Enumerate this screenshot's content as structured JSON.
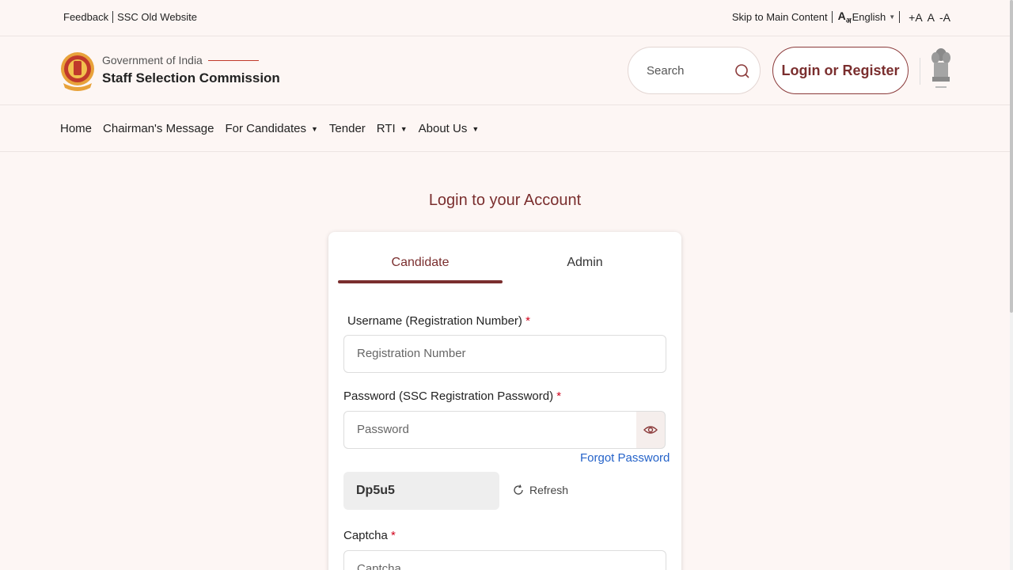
{
  "topbar": {
    "feedback": "Feedback",
    "old_website": "SSC Old Website",
    "skip": "Skip to Main Content",
    "lang_icon": "A",
    "lang_icon_sub": "अ",
    "language": "English",
    "font_increase": "+A",
    "font_normal": "A",
    "font_decrease": "-A"
  },
  "header": {
    "gov": "Government of India",
    "org": "Staff Selection Commission",
    "search_placeholder": "Search",
    "login_register": "Login or Register"
  },
  "nav": {
    "items": [
      {
        "label": "Home",
        "dropdown": false
      },
      {
        "label": "Chairman's Message",
        "dropdown": false
      },
      {
        "label": "For Candidates",
        "dropdown": true
      },
      {
        "label": "Tender",
        "dropdown": false
      },
      {
        "label": "RTI",
        "dropdown": true
      },
      {
        "label": "About Us",
        "dropdown": true
      }
    ]
  },
  "login": {
    "title": "Login to your Account",
    "tabs": [
      "Candidate",
      "Admin"
    ],
    "active_tab": "Candidate",
    "username_label": "Username (Registration Number)",
    "username_placeholder": "Registration Number",
    "password_label": "Password (SSC Registration Password)",
    "password_placeholder": "Password",
    "forgot": "Forgot Password",
    "captcha_text": "Dp5u5",
    "refresh": "Refresh",
    "captcha_label": "Captcha",
    "captcha_placeholder": "Captcha",
    "required_mark": "*"
  },
  "colors": {
    "accent": "#7a2e2e",
    "link": "#2563c9",
    "required": "#d0021b",
    "background": "#fdf6f4"
  }
}
